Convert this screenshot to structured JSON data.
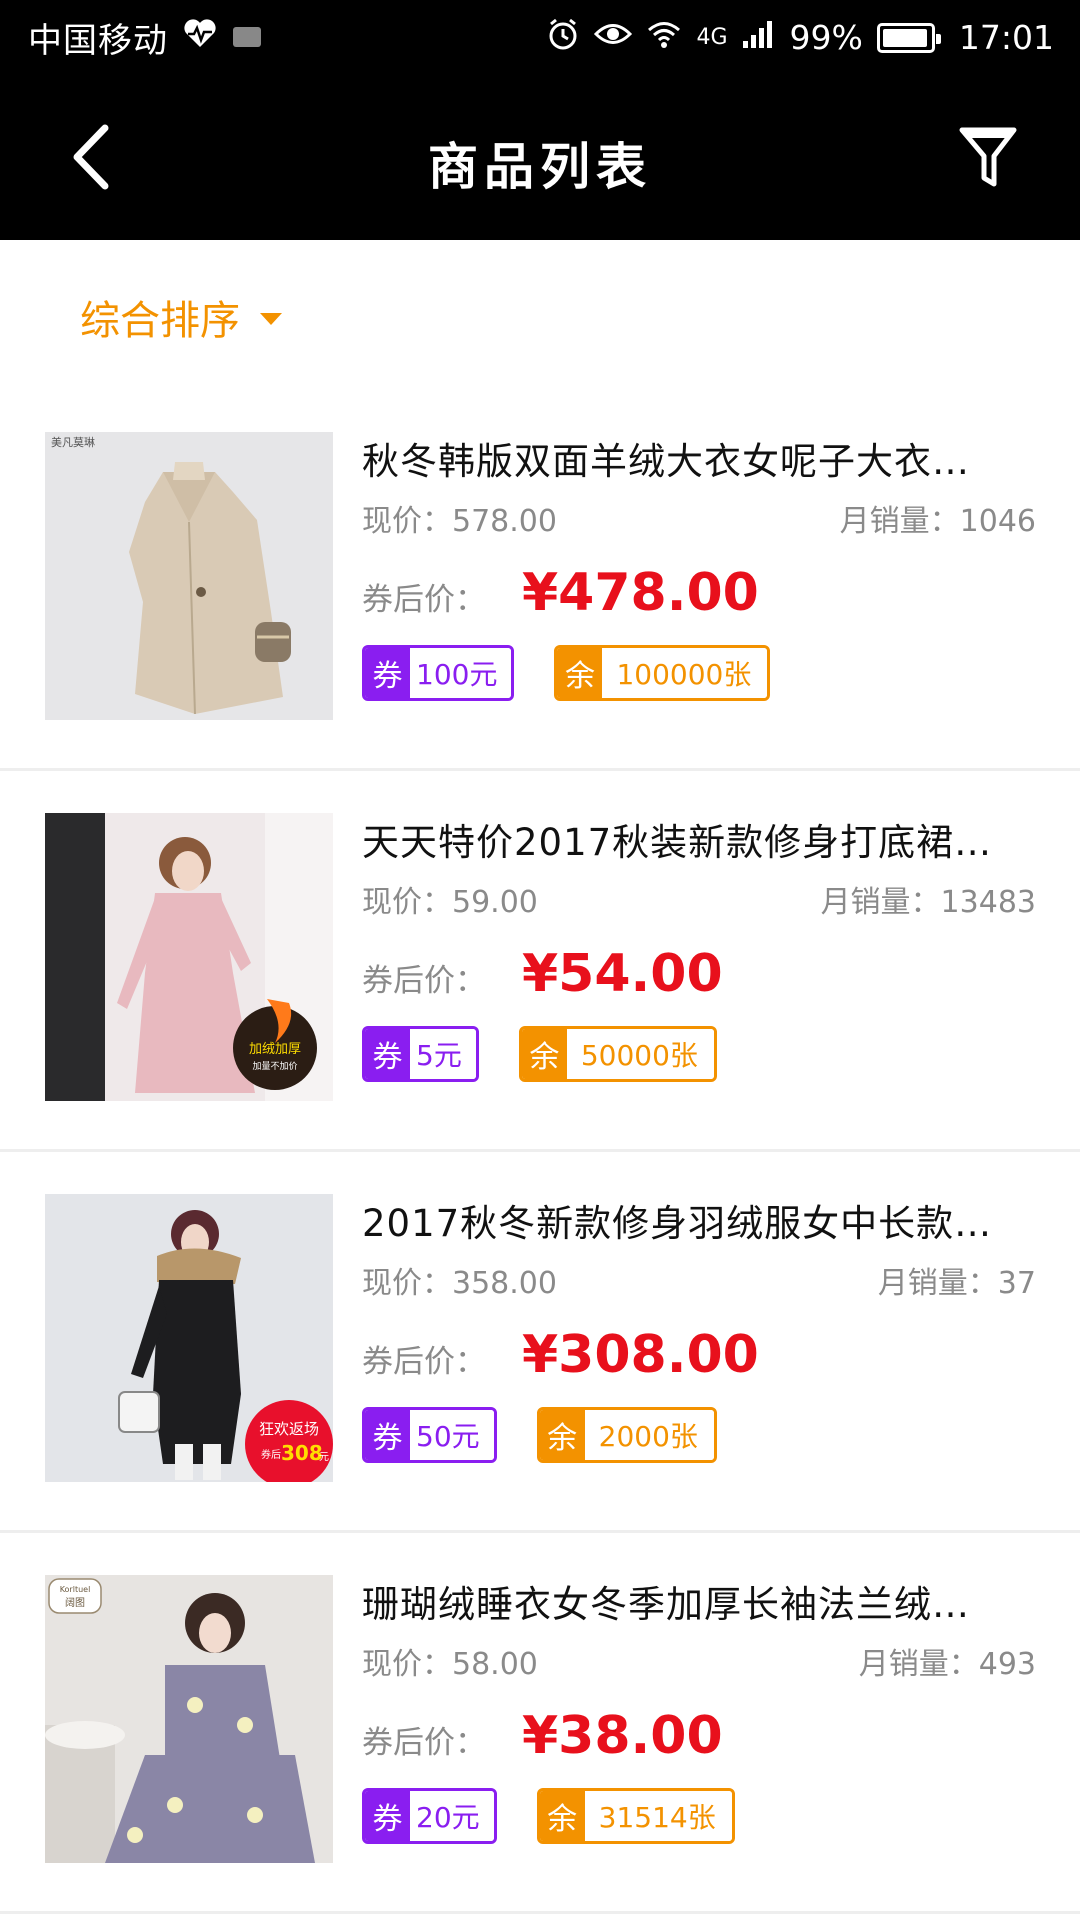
{
  "status_bar": {
    "carrier": "中国移动",
    "network": "4G",
    "battery": "99%",
    "time": "17:01"
  },
  "header": {
    "title": "商品列表"
  },
  "sort": {
    "label": "综合排序"
  },
  "labels": {
    "price_prefix": "现价：",
    "sales_prefix": "月销量：",
    "after_label": "券后价：",
    "coupon_tag": "券",
    "remain_tag": "余"
  },
  "products": [
    {
      "title": "秋冬韩版双面羊绒大衣女呢子大衣…",
      "price": "现价：578.00",
      "sales": "月销量：1046",
      "after_price": "¥478.00",
      "coupon": "100元",
      "remain": "100000张"
    },
    {
      "title": "天天特价2017秋装新款修身打底裙…",
      "price": "现价：59.00",
      "sales": "月销量：13483",
      "after_price": "¥54.00",
      "coupon": "5元",
      "remain": "50000张"
    },
    {
      "title": "2017秋冬新款修身羽绒服女中长款…",
      "price": "现价：358.00",
      "sales": "月销量：37",
      "after_price": "¥308.00",
      "coupon": "50元",
      "remain": "2000张"
    },
    {
      "title": "珊瑚绒睡衣女冬季加厚长袖法兰绒…",
      "price": "现价：58.00",
      "sales": "月销量：493",
      "after_price": "¥38.00",
      "coupon": "20元",
      "remain": "31514张"
    }
  ],
  "image_overlays": {
    "p1_brand": "美凡莫琳",
    "p2_badge_line1": "加绒加厚",
    "p2_badge_line2": "加量不加价",
    "p3_badge_line1": "狂欢返场",
    "p3_badge_prefix": "券后",
    "p3_badge_price": "308",
    "p3_badge_unit": "元",
    "p4_brand_latin": "Korltuel",
    "p4_brand_cn": "阔图"
  },
  "colors": {
    "accent_orange": "#f39200",
    "coupon_purple": "#8a1ef0",
    "price_red": "#e8101c"
  }
}
